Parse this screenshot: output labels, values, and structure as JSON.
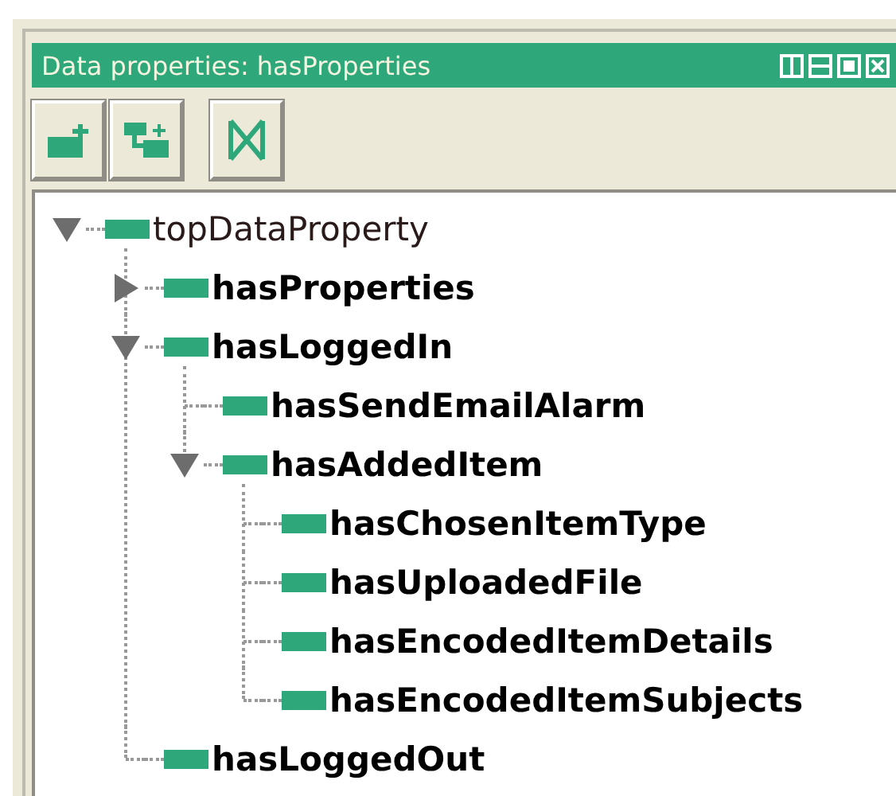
{
  "panel": {
    "title": "Data properties: hasProperties"
  },
  "toolbar": {
    "buttons": [
      {
        "kind": "add-sub"
      },
      {
        "kind": "add-sibling"
      },
      {
        "kind": "delete"
      }
    ]
  },
  "tree": [
    {
      "label": "topDataProperty",
      "bold": false,
      "expanded": true,
      "children": [
        {
          "label": "hasProperties",
          "bold": true,
          "expanded": false
        },
        {
          "label": "hasLoggedIn",
          "bold": true,
          "expanded": true,
          "children": [
            {
              "label": "hasSendEmailAlarm",
              "bold": true
            },
            {
              "label": "hasAddedItem",
              "bold": true,
              "expanded": true,
              "children": [
                {
                  "label": "hasChosenItemType",
                  "bold": true
                },
                {
                  "label": "hasUploadedFile",
                  "bold": true
                },
                {
                  "label": "hasEncodedItemDetails",
                  "bold": true
                },
                {
                  "label": "hasEncodedItemSubjects",
                  "bold": true
                }
              ]
            }
          ]
        },
        {
          "label": "hasLoggedOut",
          "bold": true
        }
      ]
    }
  ]
}
